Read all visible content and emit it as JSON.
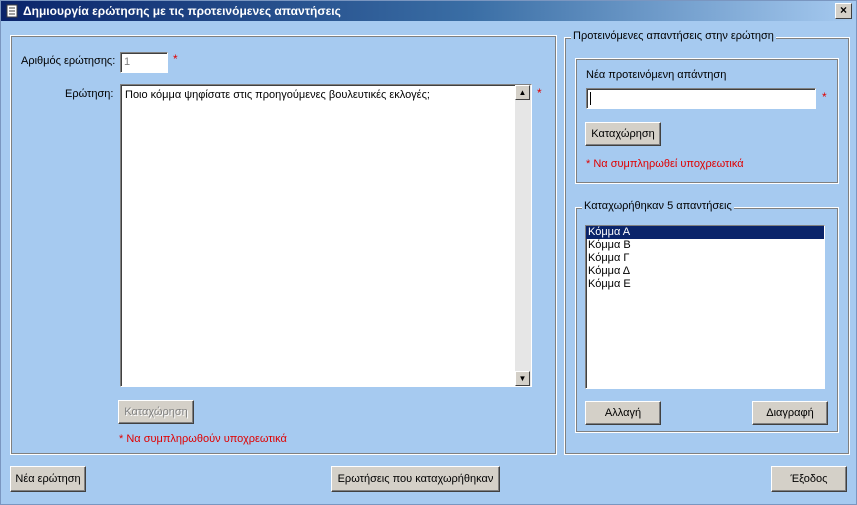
{
  "window": {
    "title": "Δημιουργία ερώτησης με τις προτεινόμενες απαντήσεις",
    "close_label": "×"
  },
  "question": {
    "number_label": "Αριθμός ερώτησης:",
    "number_value": "1",
    "text_label": "Ερώτηση:",
    "text_value": "Ποιο κόμμα ψηφίσατε στις προηγούμενες βουλευτικές εκλογές;",
    "required_mark": "*",
    "save_label": "Καταχώρηση",
    "required_note": "* Να συμπληρωθούν υποχρεωτικά"
  },
  "answers": {
    "group_title": "Προτεινόμενες απαντήσεις στην ερώτηση",
    "new_answer_label": "Νέα προτεινόμενη απάντηση",
    "new_answer_value": "",
    "required_mark": "*",
    "save_label": "Καταχώρηση",
    "required_note": "* Να συμπληρωθεί υποχρεωτικά",
    "list_title": "Καταχωρήθηκαν 5 απαντήσεις",
    "items": [
      "Κόμμα Α",
      "Κόμμα Β",
      "Κόμμα Γ",
      "Κόμμα Δ",
      "Κόμμα Ε"
    ],
    "edit_label": "Αλλαγή",
    "delete_label": "Διαγραφή"
  },
  "footer": {
    "new_question_label": "Νέα ερώτηση",
    "saved_questions_label": "Ερωτήσεις που καταχωρήθηκαν",
    "exit_label": "Έξοδος"
  }
}
